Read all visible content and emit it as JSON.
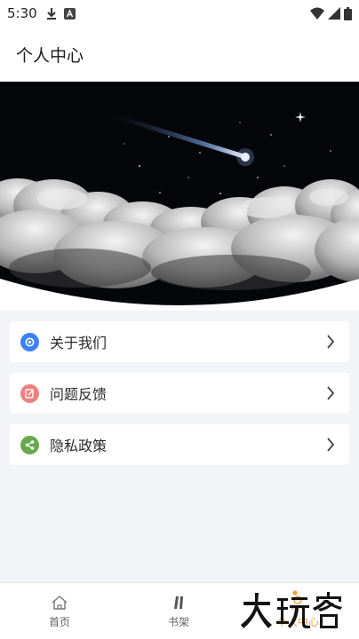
{
  "status_bar": {
    "time": "5:30",
    "left_icons": [
      "download-icon",
      "a-badge-icon"
    ],
    "right_icons": [
      "wifi-icon",
      "signal-icon",
      "battery-icon"
    ]
  },
  "header": {
    "title": "个人中心"
  },
  "hero": {
    "image": "night sky shooting star over clouds"
  },
  "menu": {
    "items": [
      {
        "label": "关于我们",
        "icon": "gear-icon",
        "color": "#3b82f6"
      },
      {
        "label": "问题反馈",
        "icon": "edit-icon",
        "color": "#ef7f7f"
      },
      {
        "label": "隐私政策",
        "icon": "share-icon",
        "color": "#6aa84f"
      }
    ]
  },
  "bottom_nav": {
    "items": [
      {
        "label": "首页",
        "icon": "home-icon",
        "active": false
      },
      {
        "label": "书架",
        "icon": "bookshelf-icon",
        "active": false
      },
      {
        "label": "个人中心",
        "icon": "person-icon",
        "active": true
      }
    ],
    "active_color": "#f0a040"
  },
  "watermark": {
    "text": "大玩客"
  }
}
